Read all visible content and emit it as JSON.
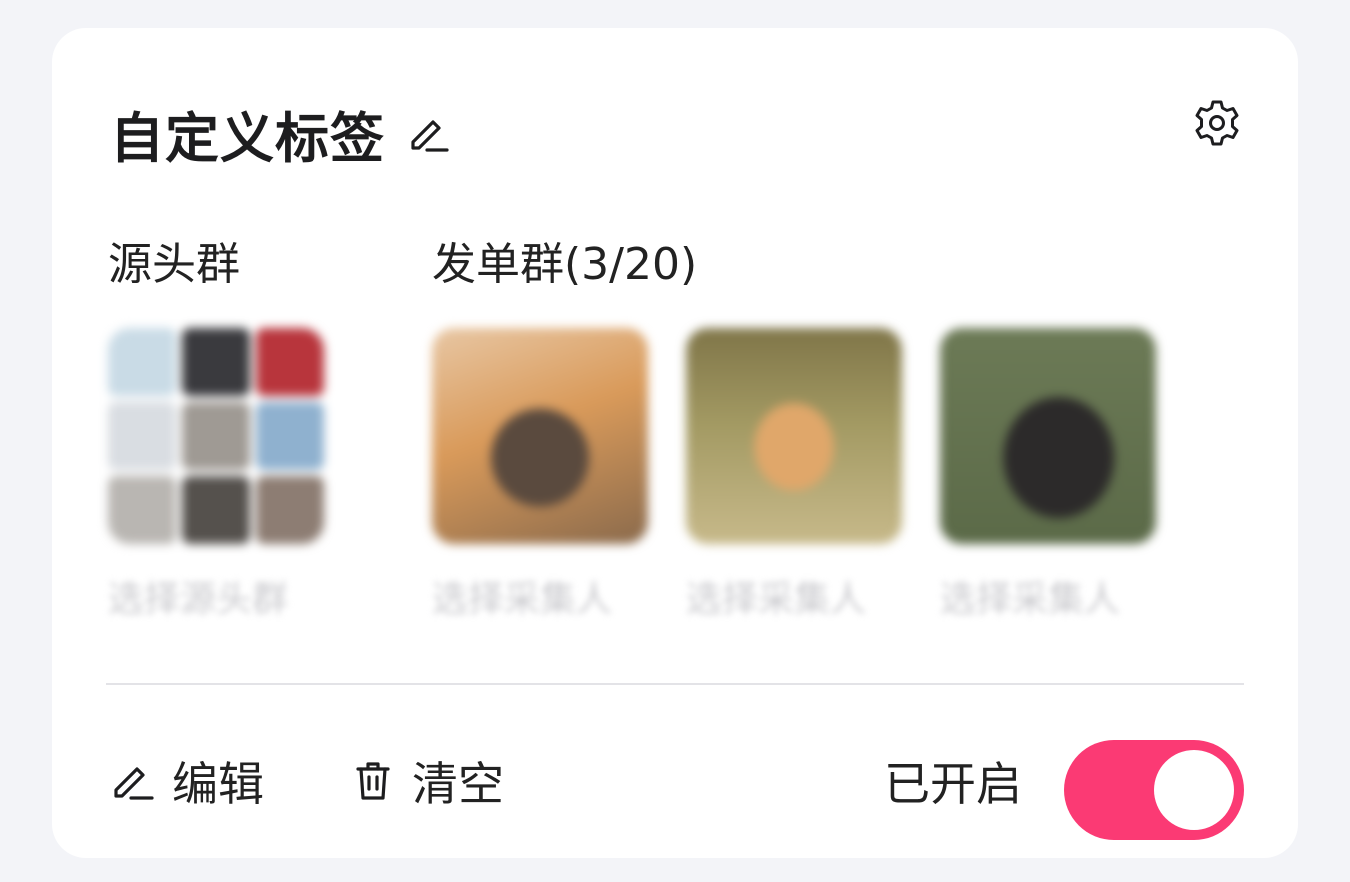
{
  "header": {
    "title": "自定义标签",
    "edit_icon": "pencil-icon",
    "settings_icon": "gear-icon"
  },
  "source_group": {
    "label": "源头群",
    "caption": "选择源头群"
  },
  "send_group": {
    "label": "发单群(3/20)",
    "items": [
      {
        "caption": "选择采集人"
      },
      {
        "caption": "选择采集人"
      },
      {
        "caption": "选择采集人"
      }
    ]
  },
  "footer": {
    "edit_label": "编辑",
    "clear_label": "清空",
    "status_label": "已开启",
    "toggle_on": true
  },
  "colors": {
    "accent": "#fb3a74",
    "background": "#f3f4f8",
    "card": "#ffffff"
  }
}
